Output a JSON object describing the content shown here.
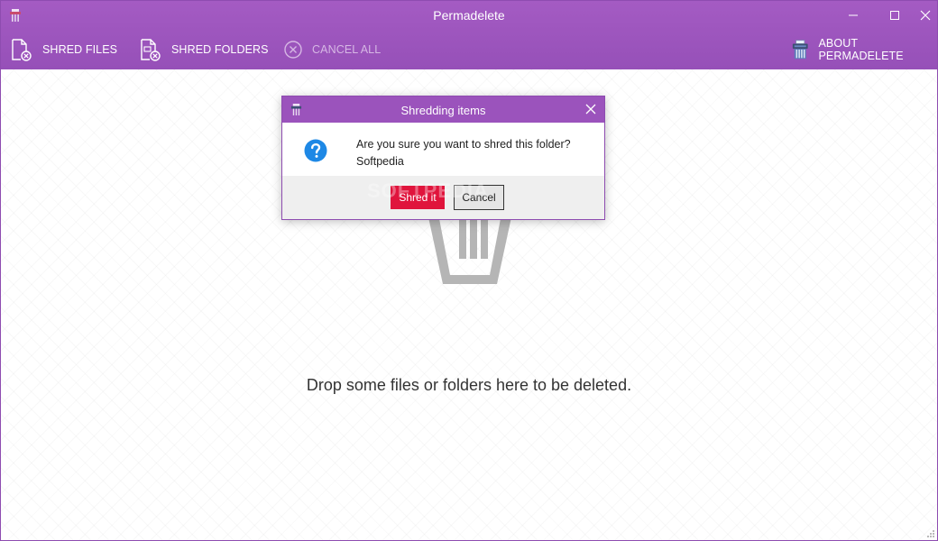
{
  "window": {
    "title": "Permadelete",
    "icons": {
      "app": "shredder-app-icon",
      "minimize": "minimize-icon",
      "maximize": "maximize-icon",
      "close": "close-icon"
    }
  },
  "toolbar": {
    "shred_files": {
      "label": "SHRED FILES",
      "icon": "file-shred-icon"
    },
    "shred_folders": {
      "label": "SHRED FOLDERS",
      "icon": "folder-shred-icon"
    },
    "cancel_all": {
      "label": "CANCEL ALL",
      "icon": "cancel-circle-icon",
      "state": "disabled"
    },
    "about": {
      "label": "ABOUT PERMADELETE",
      "icon": "shredder-icon"
    }
  },
  "content": {
    "drop_message": "Drop some files or folders here to be deleted.",
    "background_icon": "trash-bin-icon"
  },
  "dialog": {
    "title": "Shredding items",
    "message_line1": "Are you sure you want to shred this folder?",
    "message_line2": "Softpedia",
    "icon": "question-icon",
    "confirm_label": "Shred it",
    "cancel_label": "Cancel",
    "watermark": "SOFTPEDIA"
  },
  "colors": {
    "accent": "#9d54bd",
    "danger": "#e0143c",
    "question": "#1e88e5"
  }
}
